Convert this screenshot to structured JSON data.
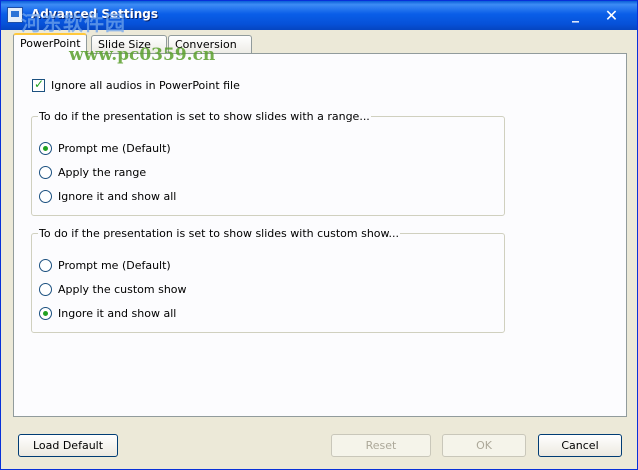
{
  "window": {
    "title": "Advanced Settings",
    "watermark": "河东软件园",
    "watermark_url": "www.pc0359.cn",
    "minimize_glyph": "_",
    "close_glyph": "✕"
  },
  "tabs": [
    {
      "label": "PowerPoint",
      "active": true
    },
    {
      "label": "Slide Size",
      "active": false
    },
    {
      "label": "Conversion",
      "active": false
    }
  ],
  "ignore_audio": {
    "label": "Ignore all audios in PowerPoint file",
    "checked": true
  },
  "range_group": {
    "title": "To do if the presentation is set to show slides with a range...",
    "options": [
      {
        "label": "Prompt me (Default)",
        "selected": true
      },
      {
        "label": "Apply the range",
        "selected": false
      },
      {
        "label": "Ignore it and show all",
        "selected": false
      }
    ]
  },
  "custom_group": {
    "title": "To do if the presentation is set to show slides with custom show...",
    "options": [
      {
        "label": "Prompt me (Default)",
        "selected": false
      },
      {
        "label": "Apply the custom show",
        "selected": false
      },
      {
        "label": "Ingore it and show all",
        "selected": true
      }
    ]
  },
  "buttons": {
    "load_default": "Load Default",
    "reset": "Reset",
    "ok": "OK",
    "cancel": "Cancel"
  },
  "colors": {
    "titlebar": "#0a5ee8",
    "check_mark": "#21a121",
    "tab_highlight": "#ffc83c"
  }
}
